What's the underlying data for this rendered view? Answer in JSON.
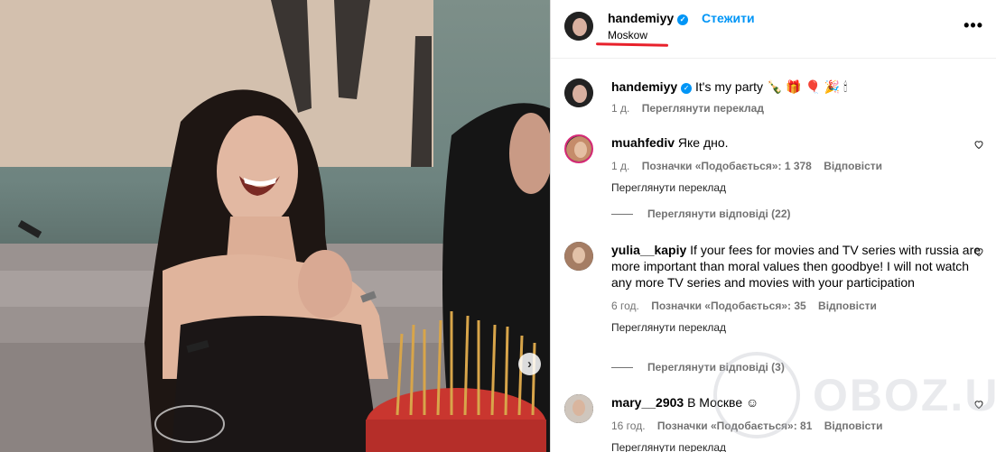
{
  "post": {
    "username": "handemiyy",
    "follow_label": "Стежити",
    "location": "Moskow",
    "more_label": "•••",
    "caption": "It's my party 🍾 🎁 🎈 🎉 🕯",
    "caption_time": "1 д.",
    "caption_translate": "Переглянути переклад",
    "carousel_next": "›"
  },
  "comments": [
    {
      "username": "muahfediv",
      "text": "Яке дно.",
      "time": "1 д.",
      "likes": "Позначки «Подобається»: 1 378",
      "reply": "Відповісти",
      "translate": "Переглянути переклад",
      "view_replies": "Переглянути відповіді (22)"
    },
    {
      "username": "yulia__kapiy",
      "text": "If your fees for movies and TV series with russia are more important than moral values then goodbye! I will not watch any more TV series and movies with your participation",
      "time": "6 год.",
      "likes": "Позначки «Подобається»: 35",
      "reply": "Відповісти",
      "translate": "Переглянути переклад",
      "view_replies": "Переглянути відповіді (3)"
    },
    {
      "username": "mary__2903",
      "text": "В Москве ☺",
      "time": "16 год.",
      "likes": "Позначки «Подобається»: 81",
      "reply": "Відповісти",
      "translate": "Переглянути переклад"
    }
  ],
  "watermark": "OBOZ.UA",
  "colors": {
    "accent": "#0095f6",
    "underline": "#e8212b",
    "muted": "#737373"
  }
}
